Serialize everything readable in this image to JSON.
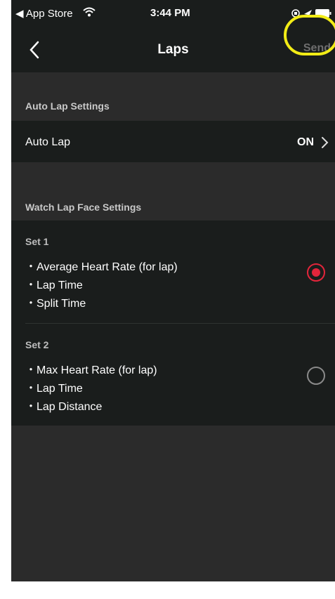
{
  "statusbar": {
    "back_app": "◀ App Store",
    "time": "3:44 PM"
  },
  "navbar": {
    "title": "Laps",
    "send_label": "Send"
  },
  "auto_lap_section": {
    "header": "Auto Lap Settings",
    "row_label": "Auto Lap",
    "row_value": "ON"
  },
  "watch_face_section": {
    "header": "Watch Lap Face Settings",
    "sets": [
      {
        "title": "Set 1",
        "items": [
          "・Average Heart Rate (for lap)",
          "・Lap Time",
          "・Split Time"
        ],
        "selected": true
      },
      {
        "title": "Set 2",
        "items": [
          "・Max Heart Rate (for lap)",
          "・Lap Time",
          "・Lap Distance"
        ],
        "selected": false
      }
    ]
  },
  "colors": {
    "accent_selected": "#e3253b",
    "highlight_ring": "#f2ec16",
    "background": "#2b2b2b",
    "row_background": "#1a1d1c"
  }
}
